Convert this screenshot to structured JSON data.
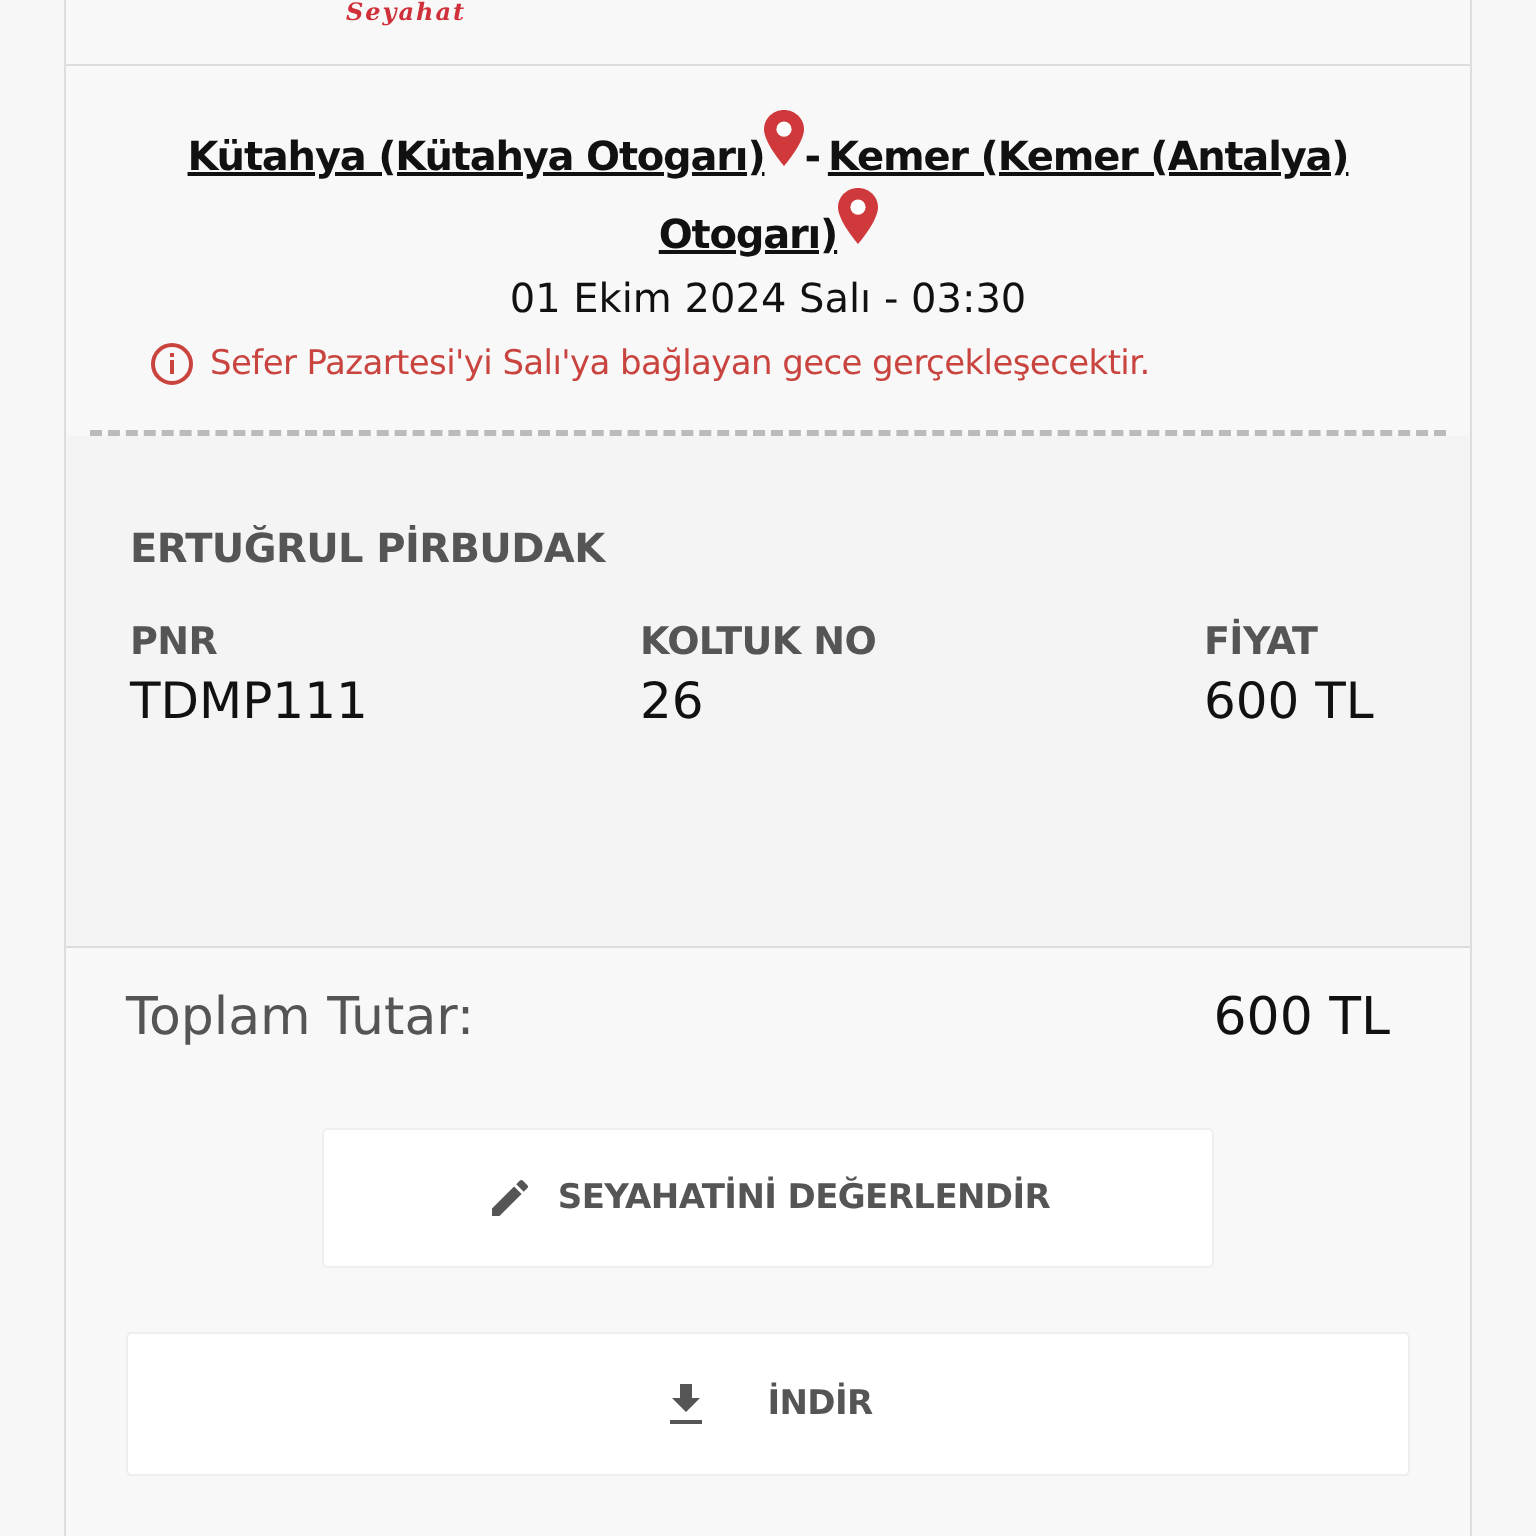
{
  "logo": "Seyahat",
  "route": {
    "origin": "Kütahya (Kütahya Otogarı)",
    "separator": "-",
    "destination_lines": [
      "Kemer (Kemer (Antalya)",
      "Otogarı)"
    ]
  },
  "departure": "01 Ekim 2024 Salı - 03:30",
  "notice": "Sefer Pazartesi'yi Salı'ya bağlayan gece gerçekleşecektir.",
  "passenger": {
    "name": "ERTUĞRUL PİRBUDAK",
    "fields": [
      {
        "label": "PNR",
        "value": "TDMP111"
      },
      {
        "label": "KOLTUK NO",
        "value": "26"
      },
      {
        "label": "FİYAT",
        "value": "600 TL"
      }
    ]
  },
  "total": {
    "label": "Toplam Tutar:",
    "value": "600 TL"
  },
  "buttons": [
    {
      "kind": "rate",
      "label": "SEYAHATİNİ DEĞERLENDİR"
    },
    {
      "kind": "download",
      "label": "İNDİR"
    }
  ]
}
